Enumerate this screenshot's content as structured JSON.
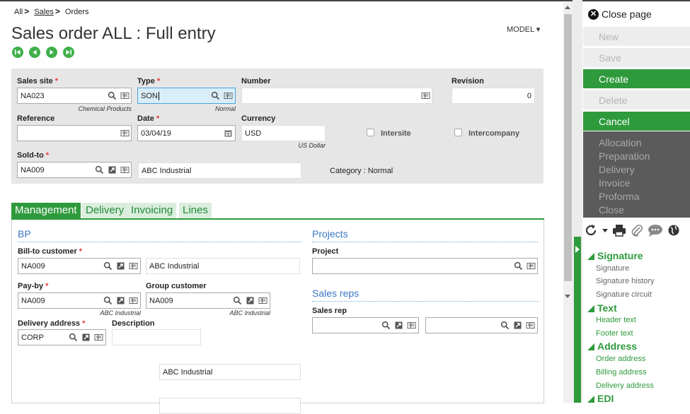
{
  "breadcrumb": {
    "root": "All",
    "sales": "Sales",
    "orders": "Orders"
  },
  "page": {
    "title": "Sales order ALL : Full entry",
    "model_label": "MODEL"
  },
  "header": {
    "sales_site": {
      "label": "Sales site",
      "value": "NA023",
      "hint": "Chemical Products"
    },
    "type": {
      "label": "Type",
      "value": "SON",
      "hint": "Normal"
    },
    "number": {
      "label": "Number",
      "value": ""
    },
    "revision": {
      "label": "Revision",
      "value": "0"
    },
    "reference": {
      "label": "Reference",
      "value": ""
    },
    "date": {
      "label": "Date",
      "value": "03/04/19"
    },
    "currency": {
      "label": "Currency",
      "value": "USD",
      "hint": "US Dollar"
    },
    "intersite": {
      "label": "Intersite",
      "checked": false
    },
    "intercompany": {
      "label": "Intercompany",
      "checked": false
    },
    "sold_to": {
      "label": "Sold-to",
      "value": "NA009",
      "name": "ABC Industrial"
    },
    "category": "Category : Normal"
  },
  "tabs": [
    "Management",
    "Delivery",
    "Invoicing",
    "Lines"
  ],
  "bp": {
    "section": "BP",
    "bill_to": {
      "label": "Bill-to customer",
      "value": "NA009",
      "name": "ABC Industrial"
    },
    "pay_by": {
      "label": "Pay-by",
      "value": "NA009",
      "hint": "ABC Industrial"
    },
    "group_customer": {
      "label": "Group customer",
      "value": "NA009",
      "hint": "ABC Industrial"
    },
    "delivery_address": {
      "label": "Delivery address",
      "value": "CORP"
    },
    "description": {
      "label": "Description",
      "value": ""
    },
    "address_name": "ABC Industrial"
  },
  "projects": {
    "section": "Projects",
    "project_label": "Project",
    "project_value": ""
  },
  "sales_reps": {
    "section": "Sales reps",
    "label": "Sales rep",
    "rep1": "",
    "rep2": ""
  },
  "sidebar": {
    "close_page": "Close page",
    "buttons": [
      {
        "label": "New",
        "state": "disabled"
      },
      {
        "label": "Save",
        "state": "disabled"
      },
      {
        "label": "Create",
        "state": "active"
      },
      {
        "label": "Delete",
        "state": "disabled"
      },
      {
        "label": "Cancel",
        "state": "active"
      }
    ],
    "actions": [
      "Allocation",
      "Preparation",
      "Delivery",
      "Invoice",
      "Proforma",
      "Close"
    ],
    "icons": [
      "refresh-icon",
      "dropdown-caret-icon",
      "print-icon",
      "attachment-icon",
      "comment-icon",
      "globe-icon"
    ],
    "groups": [
      {
        "title": "Signature",
        "items": [
          {
            "label": "Signature",
            "color": "gray"
          },
          {
            "label": "Signature history",
            "color": "gray"
          },
          {
            "label": "Signature circuit",
            "color": "gray"
          }
        ]
      },
      {
        "title": "Text",
        "items": [
          {
            "label": "Header text",
            "color": "green"
          },
          {
            "label": "Footer text",
            "color": "green"
          }
        ]
      },
      {
        "title": "Address",
        "items": [
          {
            "label": "Order address",
            "color": "green"
          },
          {
            "label": "Billing address",
            "color": "green"
          },
          {
            "label": "Delivery address",
            "color": "green"
          }
        ]
      },
      {
        "title": "EDI",
        "items": []
      }
    ]
  },
  "colors": {
    "accent_green": "#2e9a3c",
    "section_blue": "#3a76c4",
    "required_red": "#e53935"
  }
}
